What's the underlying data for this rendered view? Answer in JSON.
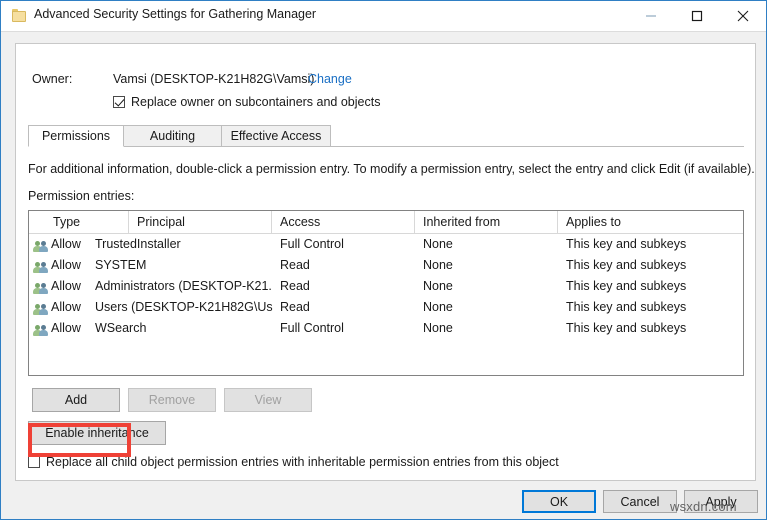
{
  "window": {
    "title": "Advanced Security Settings for Gathering Manager",
    "icon": "folder-icon",
    "controls": {
      "minimize": "minimize-icon",
      "maximize": "maximize-icon",
      "close": "close-icon"
    }
  },
  "owner": {
    "label": "Owner:",
    "value": "Vamsi (DESKTOP-K21H82G\\Vamsi)",
    "change_link": "Change",
    "replace_owner_checkbox": {
      "label": "Replace owner on subcontainers and objects",
      "checked": true
    }
  },
  "tabs": [
    {
      "label": "Permissions",
      "active": true
    },
    {
      "label": "Auditing",
      "active": false
    },
    {
      "label": "Effective Access",
      "active": false
    }
  ],
  "main": {
    "info_text": "For additional information, double-click a permission entry. To modify a permission entry, select the entry and click Edit (if available).",
    "entries_label": "Permission entries:",
    "columns": [
      "Type",
      "Principal",
      "Access",
      "Inherited from",
      "Applies to"
    ],
    "rows": [
      {
        "icon": "group-users-icon",
        "type": "Allow",
        "principal": "TrustedInstaller",
        "access": "Full Control",
        "inherited_from": "None",
        "applies_to": "This key and subkeys"
      },
      {
        "icon": "group-users-icon",
        "type": "Allow",
        "principal": "SYSTEM",
        "access": "Read",
        "inherited_from": "None",
        "applies_to": "This key and subkeys"
      },
      {
        "icon": "group-users-icon",
        "type": "Allow",
        "principal": "Administrators (DESKTOP-K21...",
        "access": "Read",
        "inherited_from": "None",
        "applies_to": "This key and subkeys"
      },
      {
        "icon": "group-users-icon",
        "type": "Allow",
        "principal": "Users (DESKTOP-K21H82G\\Us...",
        "access": "Read",
        "inherited_from": "None",
        "applies_to": "This key and subkeys"
      },
      {
        "icon": "group-users-icon",
        "type": "Allow",
        "principal": "WSearch",
        "access": "Full Control",
        "inherited_from": "None",
        "applies_to": "This key and subkeys"
      }
    ]
  },
  "entry_buttons": {
    "add": "Add",
    "remove": "Remove",
    "view": "View",
    "enable_inheritance": "Enable inheritance"
  },
  "replace_child_checkbox": {
    "label": "Replace all child object permission entries with inheritable permission entries from this object",
    "checked": false
  },
  "footer": {
    "ok": "OK",
    "cancel": "Cancel",
    "apply": "Apply"
  },
  "watermark": "wsxdn.com",
  "colors": {
    "window_border": "#2f7fc4",
    "link": "#1a6fc4",
    "highlight": "#ef4136",
    "focus": "#0078d7",
    "panel": "#ffffff",
    "chrome": "#f0f0f0"
  }
}
